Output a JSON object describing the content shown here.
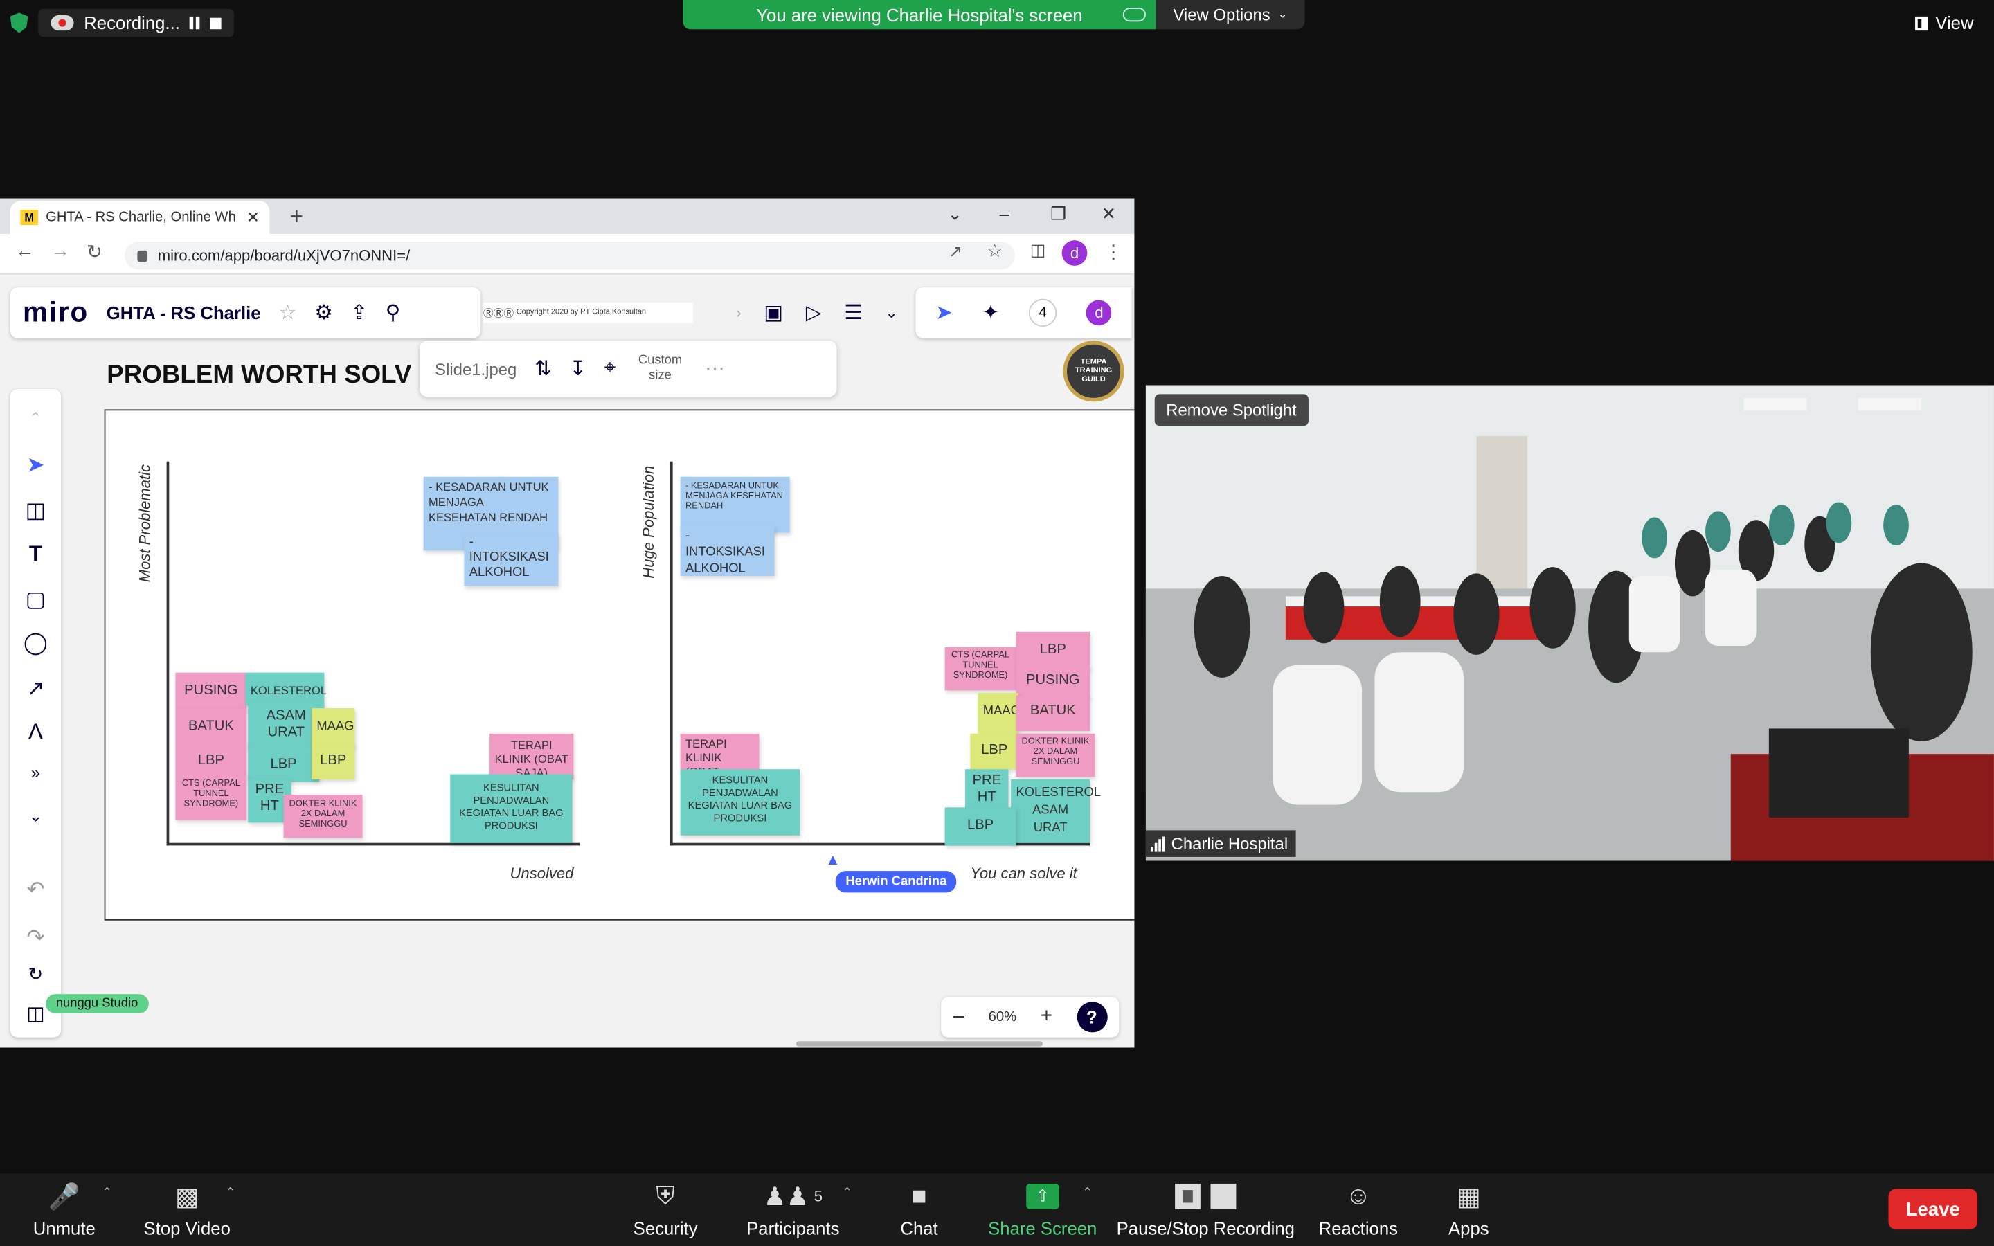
{
  "zoom_top": {
    "recording_label": "Recording...",
    "viewing_banner": "You are viewing Charlie Hospital's screen",
    "view_options": "View Options",
    "view": "View"
  },
  "browser": {
    "tab_title": "GHTA - RS Charlie, Online Whitel",
    "url": "miro.com/app/board/uXjVO7nONNI=/",
    "avatar_letter": "d"
  },
  "miro": {
    "logo": "miro",
    "board_name": "GHTA - RS Charlie",
    "copyright": "Copyright 2020 by PT Cipta Konsultan",
    "online_count": "4",
    "image_name": "Slide1.jpeg",
    "custom_size": "Custom size",
    "slide_title": "PROBLEM WORTH SOLV",
    "seal_text": "TEMPA TRAINING GUILD",
    "zoom_level": "60%",
    "help": "?",
    "cursor_user": "Herwin Candrina",
    "studio_tag": "nunggu Studio",
    "chart_left": {
      "y_label": "Most Problematic",
      "x_label": "Unsolved",
      "notes": {
        "kesadaran": "- KESADARAN UNTUK MENJAGA KESEHATAN RENDAH",
        "intoksikasi": "- INTOKSIKASI ALKOHOL",
        "pusing": "PUSING",
        "kolesterol": "KOLESTEROL",
        "batuk": "BATUK",
        "asam_urat": "ASAM URAT",
        "maag": "MAAG",
        "lbp1": "LBP",
        "lbp2": "LBP",
        "lbp3": "LBP",
        "cts": "CTS (CARPAL TUNNEL SYNDROME)",
        "pre_ht": "PRE HT",
        "dokter": "DOKTER KLINIK 2X DALAM SEMINGGU",
        "terapi": "TERAPI KLINIK (OBAT SAJA)",
        "kesulitan": "KESULITAN PENJADWALAN KEGIATAN LUAR BAG PRODUKSI"
      }
    },
    "chart_right": {
      "y_label": "Huge Population",
      "x_label": "You can solve it",
      "notes": {
        "kesadaran": "- KESADARAN UNTUK MENJAGA KESEHATAN RENDAH",
        "intoksikasi": "- INTOKSIKASI ALKOHOL",
        "terapi": "TERAPI KLINIK (OBAT SAJA)",
        "kesulitan": "KESULITAN PENJADWALAN KEGIATAN LUAR BAG PRODUKSI",
        "cts": "CTS (CARPAL TUNNEL SYNDROME)",
        "lbp1": "LBP",
        "pusing": "PUSING",
        "maag": "MAAG",
        "batuk": "BATUK",
        "lbp2": "LBP",
        "dokter": "DOKTER KLINIK 2X DALAM SEMINGGU",
        "pre_ht": "PRE HT",
        "kolesterol": "KOLESTEROL ASAM URAT",
        "lbp3": "LBP"
      }
    }
  },
  "video": {
    "remove_spotlight": "Remove Spotlight",
    "participant_name": "Charlie Hospital"
  },
  "bottom": {
    "unmute": "Unmute",
    "stop_video": "Stop Video",
    "security": "Security",
    "participants": "Participants",
    "participants_count": "5",
    "chat": "Chat",
    "share_screen": "Share Screen",
    "pause_stop_recording": "Pause/Stop Recording",
    "reactions": "Reactions",
    "apps": "Apps",
    "leave": "Leave"
  }
}
